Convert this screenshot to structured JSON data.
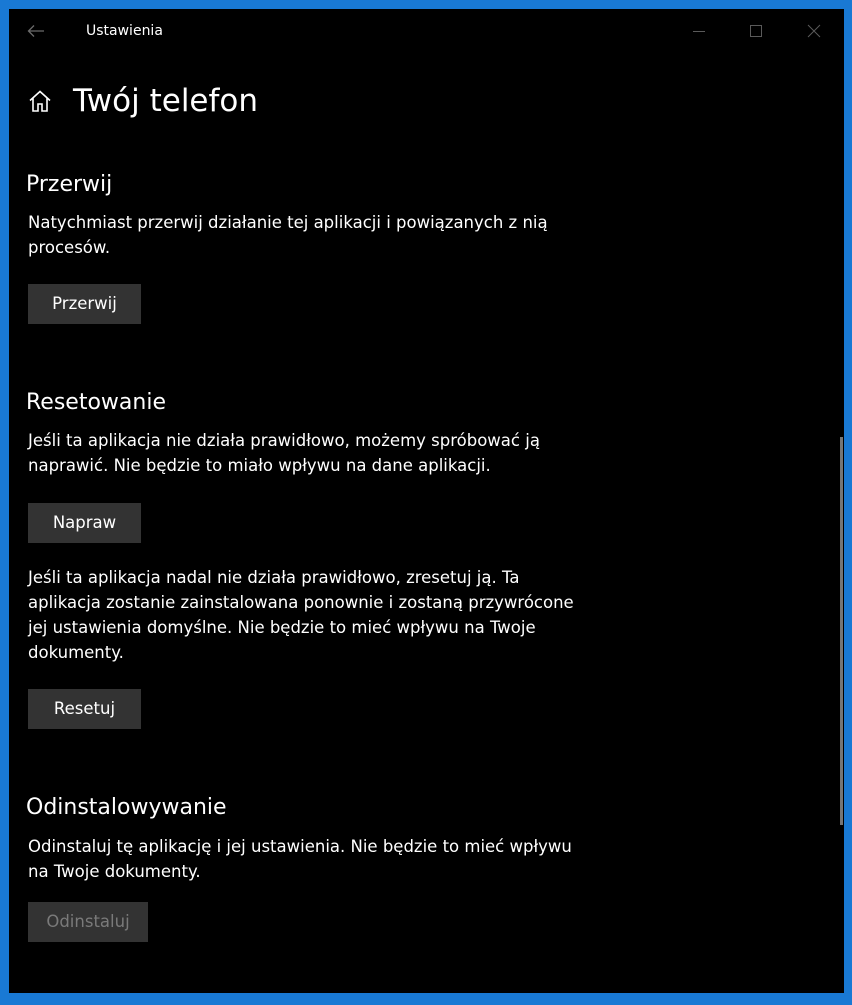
{
  "window": {
    "title": "Ustawienia"
  },
  "page": {
    "title": "Twój telefon"
  },
  "sections": {
    "terminate": {
      "heading": "Przerwij",
      "description": "Natychmiast przerwij działanie tej aplikacji i powiązanych z nią procesów.",
      "button_label": "Przerwij"
    },
    "reset": {
      "heading": "Resetowanie",
      "repair_description": "Jeśli ta aplikacja nie działa prawidłowo, możemy spróbować ją naprawić. Nie będzie to miało wpływu na dane aplikacji.",
      "repair_button_label": "Napraw",
      "reset_description": "Jeśli ta aplikacja nadal nie działa prawidłowo, zresetuj ją. Ta aplikacja zostanie zainstalowana ponownie i zostaną przywrócone jej ustawienia domyślne. Nie będzie to mieć wpływu na Twoje dokumenty.",
      "reset_button_label": "Resetuj"
    },
    "uninstall": {
      "heading": "Odinstalowywanie",
      "description": "Odinstaluj tę aplikację i jej ustawienia. Nie będzie to mieć wpływu na Twoje dokumenty.",
      "button_label": "Odinstaluj",
      "button_disabled": true
    }
  },
  "icons": {
    "back": "arrow-left-icon",
    "home": "home-icon",
    "minimize": "minimize-icon",
    "maximize": "maximize-icon",
    "close": "close-icon"
  },
  "colors": {
    "desktop_accent": "#1979d4",
    "window_background": "#000000",
    "button_background": "#333333",
    "disabled_text": "#7a7a7a"
  }
}
